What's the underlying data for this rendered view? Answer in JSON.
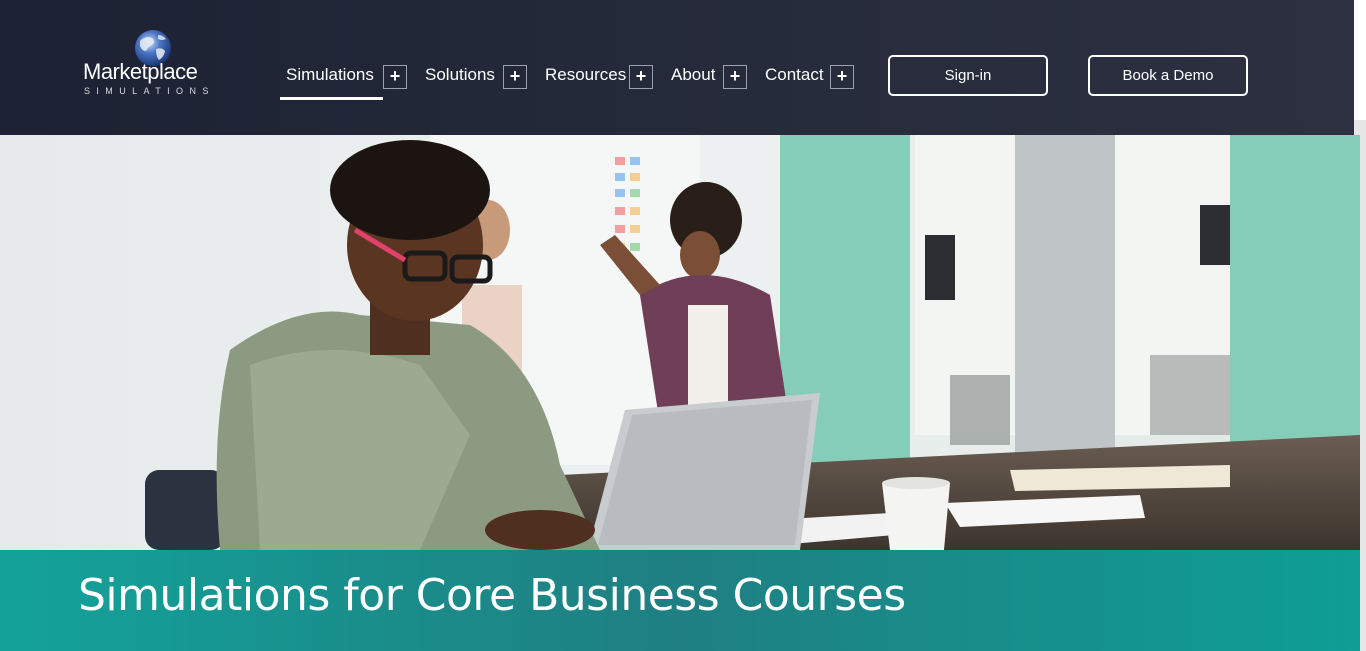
{
  "brand": {
    "name": "Marketplace",
    "tagline": "SIMULATIONS"
  },
  "nav": {
    "items": [
      {
        "label": "Simulations",
        "expand_symbol": "+",
        "active": true
      },
      {
        "label": "Solutions",
        "expand_symbol": "+"
      },
      {
        "label": "Resources",
        "expand_symbol": "+"
      },
      {
        "label": "About",
        "expand_symbol": "+"
      },
      {
        "label": "Contact",
        "expand_symbol": "+"
      }
    ],
    "signin_label": "Sign-in",
    "demo_label": "Book a Demo"
  },
  "hero": {
    "image": "students-working-laptop-whiteboard-photo"
  },
  "page": {
    "title": "Simulations for Core Business Courses"
  },
  "colors": {
    "header_bg": "#232838",
    "band_accent": "#13a39a",
    "text_light": "#ffffff"
  }
}
